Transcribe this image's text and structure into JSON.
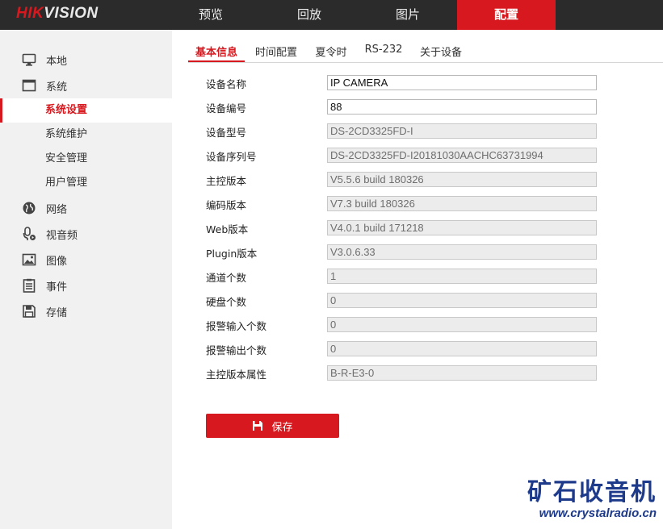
{
  "brand": {
    "part1": "HIK",
    "part2": "VISION"
  },
  "nav": {
    "preview": "预览",
    "playback": "回放",
    "picture": "图片",
    "config": "配置"
  },
  "sidebar": {
    "local": "本地",
    "system": "系统",
    "system_settings": "系统设置",
    "maintenance": "系统维护",
    "security": "安全管理",
    "user_mgmt": "用户管理",
    "network": "网络",
    "video_audio": "视音频",
    "image": "图像",
    "event": "事件",
    "storage": "存储"
  },
  "tabs": {
    "basic_info": "基本信息",
    "time_settings": "时间配置",
    "dst": "夏令时",
    "rs232": "RS-232",
    "about": "关于设备"
  },
  "form": {
    "device_name": {
      "label": "设备名称",
      "value": "IP CAMERA"
    },
    "device_no": {
      "label": "设备编号",
      "value": "88"
    },
    "model": {
      "label": "设备型号",
      "value": "DS-2CD3325FD-I"
    },
    "serial": {
      "label": "设备序列号",
      "value": "DS-2CD3325FD-I20181030AACHC63731994"
    },
    "firmware": {
      "label": "主控版本",
      "value": "V5.5.6 build 180326"
    },
    "encoding": {
      "label": "编码版本",
      "value": "V7.3 build 180326"
    },
    "web": {
      "label": "Web版本",
      "value": "V4.0.1 build 171218"
    },
    "plugin": {
      "label": "Plugin版本",
      "value": "V3.0.6.33"
    },
    "channels": {
      "label": "通道个数",
      "value": "1"
    },
    "hdd": {
      "label": "硬盘个数",
      "value": "0"
    },
    "alarm_in": {
      "label": "报警输入个数",
      "value": "0"
    },
    "alarm_out": {
      "label": "报警输出个数",
      "value": "0"
    },
    "firmware_attr": {
      "label": "主控版本属性",
      "value": "B-R-E3-0"
    }
  },
  "save_label": "保存",
  "watermark": {
    "cn": "矿石收音机",
    "url": "www.crystalradio.cn"
  },
  "colors": {
    "accent": "#d7191f",
    "topbar": "#2b2b2b",
    "sidebar": "#f1f1f1",
    "watermark": "#1e3a8a"
  },
  "icons": {
    "local": "monitor-icon",
    "system": "window-icon",
    "network": "globe-icon",
    "video_audio": "microphone-icon",
    "image": "image-icon",
    "event": "list-icon",
    "storage": "floppy-icon",
    "save": "floppy-icon"
  }
}
